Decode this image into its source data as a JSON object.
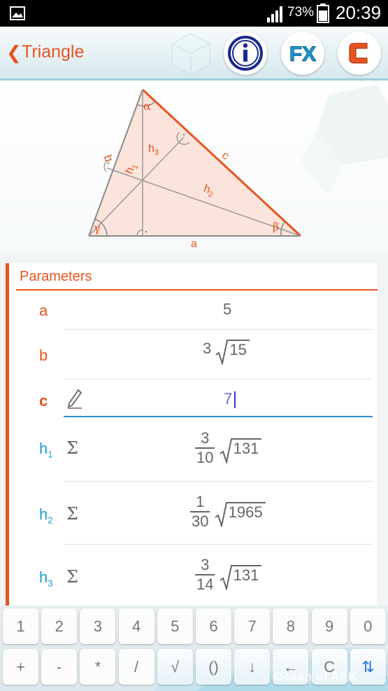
{
  "status_bar": {
    "battery_percent": "73%",
    "time": "20:39"
  },
  "action_bar": {
    "back_glyph": "❮",
    "title": "Triangle",
    "buttons": [
      {
        "name": "info",
        "glyph": "i",
        "color": "#1a2a8c"
      },
      {
        "name": "formula",
        "glyph": "FX",
        "color": "#1a9ad6"
      },
      {
        "name": "clear",
        "glyph": "C",
        "color": "#e8531f"
      }
    ]
  },
  "diagram": {
    "labels": {
      "alpha": "α",
      "beta": "β",
      "gamma": "γ",
      "a": "a",
      "b": "b",
      "c": "c",
      "h1": "h",
      "h1_sub": "1",
      "h2": "h",
      "h2_sub": "2",
      "h3": "h",
      "h3_sub": "3"
    },
    "colors": {
      "side_c": "#e8531f",
      "fill": "#fbe4db",
      "stroke": "#8a8a8a",
      "label": "#e8531f"
    }
  },
  "parameters": {
    "title": "Parameters",
    "rows": [
      {
        "label": "a",
        "value": "5"
      },
      {
        "label": "b",
        "coef": "3",
        "radicand": "15"
      },
      {
        "label": "c",
        "value": "7",
        "editing": true
      },
      {
        "label": "h",
        "sub": "1",
        "num": "3",
        "den": "10",
        "radicand": "131"
      },
      {
        "label": "h",
        "sub": "2",
        "num": "1",
        "den": "30",
        "radicand": "1965"
      },
      {
        "label": "h",
        "sub": "3",
        "num": "3",
        "den": "14",
        "radicand": "131"
      }
    ],
    "sigma_glyph": "Σ"
  },
  "keyboard": {
    "row1": [
      "1",
      "2",
      "3",
      "4",
      "5",
      "6",
      "7",
      "8",
      "9",
      "0"
    ],
    "row2": [
      "+",
      "-",
      "*",
      "/",
      "√",
      "()",
      "↓",
      "←",
      "C",
      "⇅"
    ]
  },
  "watermark": "Ocean of APK"
}
